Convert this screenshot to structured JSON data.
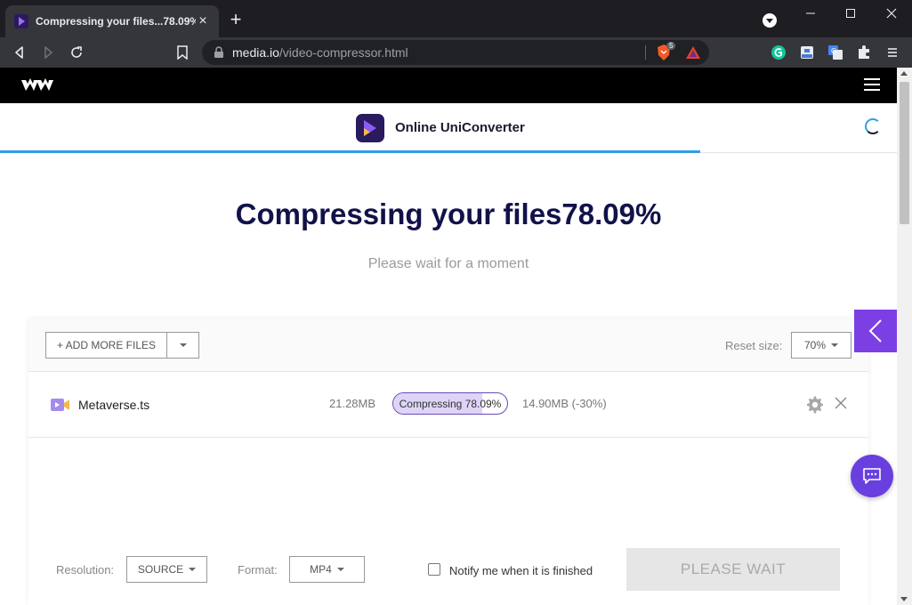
{
  "browser": {
    "tab_title": "Compressing your files...78.09%",
    "tab_close": "×",
    "new_tab": "+",
    "url_host": "media.io",
    "url_path": "/video-compressor.html",
    "brave_badge": "5"
  },
  "product": {
    "name": "Online UniConverter"
  },
  "hero": {
    "title": "Compressing your files78.09%",
    "subtitle": "Please wait for a moment"
  },
  "toolbar": {
    "add_files_label": "+ ADD MORE FILES",
    "reset_size_label": "Reset size:",
    "reset_size_value": "70%"
  },
  "file": {
    "name": "Metaverse.ts",
    "original_size": "21.28MB",
    "status_text": "Compressing 78.09%",
    "progress": 0.7809,
    "new_size": "14.90MB (-30%)"
  },
  "settings": {
    "resolution_label": "Resolution:",
    "resolution_value": "SOURCE",
    "format_label": "Format:",
    "format_value": "MP4",
    "notify_label": "Notify me when it is finished",
    "action_label": "PLEASE WAIT"
  },
  "colors": {
    "accent": "#7b3fe4",
    "progress_fill": "#ddd4f6",
    "title": "#12124a"
  }
}
